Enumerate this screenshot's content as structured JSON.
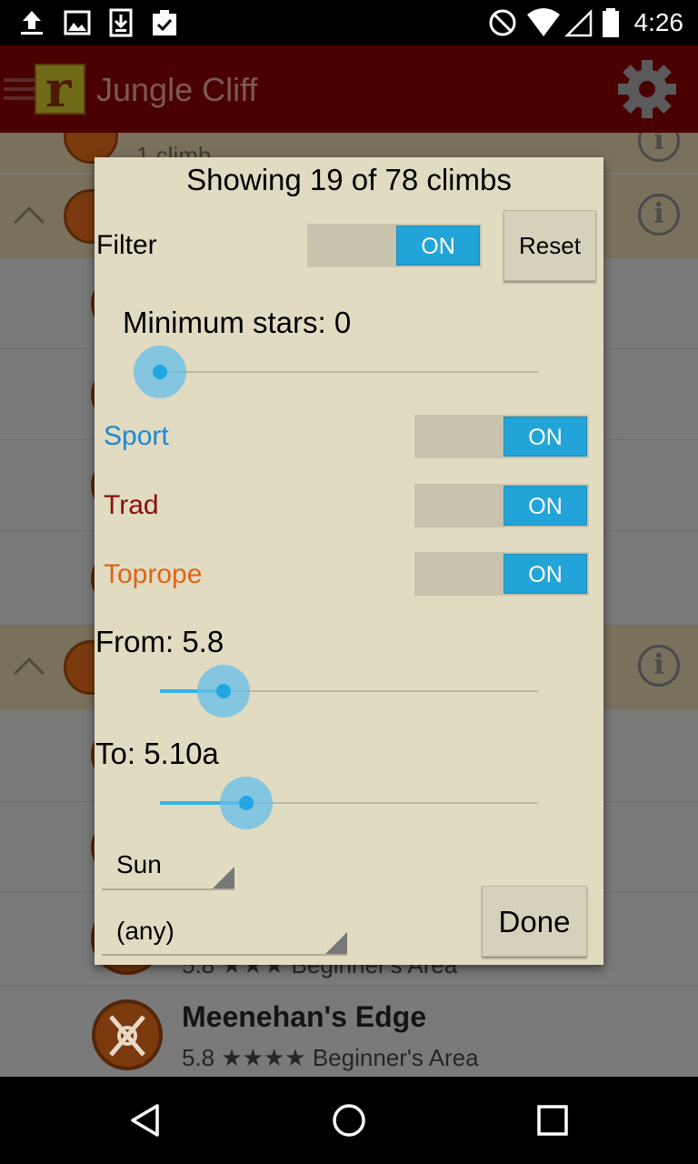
{
  "status_bar": {
    "time": "4:26",
    "left_icons": [
      "upload-icon",
      "image-icon",
      "download-icon",
      "clipboard-check-icon"
    ],
    "right_icons": [
      "do-not-disturb-icon",
      "wifi-icon",
      "signal-icon",
      "battery-icon"
    ]
  },
  "app_bar": {
    "logo_letter": "r",
    "title": "Jungle Cliff"
  },
  "background_list": {
    "partial_row_text": "1 climb",
    "routes": [
      {
        "name": "",
        "meta": "5.8 ★★★ Beginner's Area"
      },
      {
        "name": "Meenehan's Edge",
        "meta": "5.8 ★★★★ Beginner's Area"
      }
    ]
  },
  "dialog": {
    "title": "Showing 19 of 78 climbs",
    "filter_label": "Filter",
    "filter_switch": "ON",
    "reset_label": "Reset",
    "min_stars_label": "Minimum stars: 0",
    "min_stars_value": 0,
    "sport_label": "Sport",
    "sport_switch": "ON",
    "trad_label": "Trad",
    "trad_switch": "ON",
    "toprope_label": "Toprope",
    "toprope_switch": "ON",
    "from_label": "From: 5.8",
    "to_label": "To: 5.10a",
    "sun_select": "Sun",
    "any_select": "(any)",
    "done_label": "Done",
    "colors": {
      "sport": "#1e88d2",
      "trad": "#8b0d0d",
      "toprope": "#e0631a",
      "switch_on": "#23a4d8"
    }
  }
}
